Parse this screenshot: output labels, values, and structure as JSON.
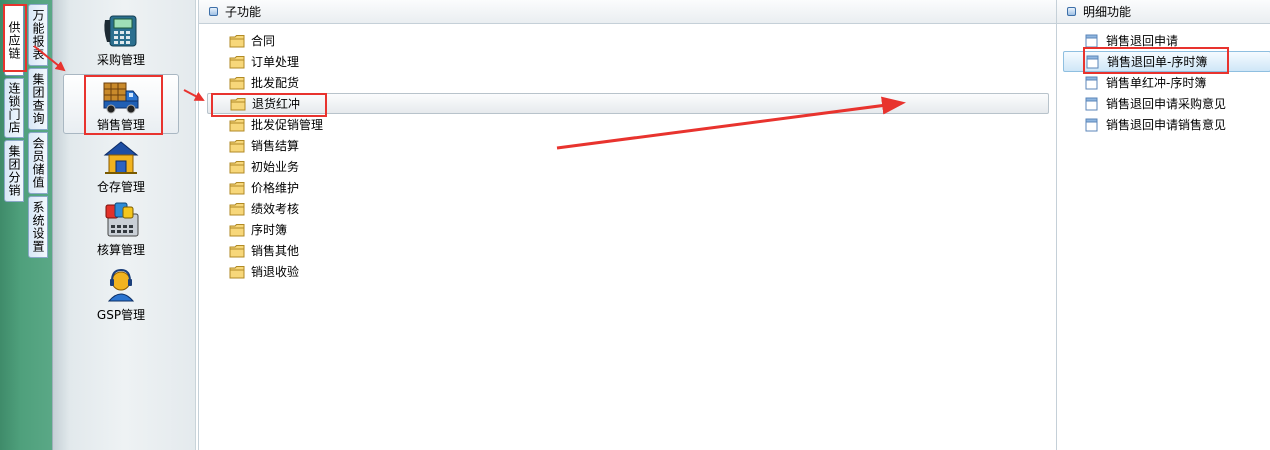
{
  "vertical_tabs": [
    {
      "label": "供应链",
      "active": true
    },
    {
      "label": "连锁门店",
      "active": false
    },
    {
      "label": "集团分销",
      "active": false
    },
    {
      "label": "万能报表",
      "active": false
    },
    {
      "label": "集团查询",
      "active": false
    },
    {
      "label": "会员储值",
      "active": false
    },
    {
      "label": "系统设置",
      "active": false
    }
  ],
  "modules": [
    {
      "label": "采购管理",
      "icon": "phone-register-icon"
    },
    {
      "label": "销售管理",
      "icon": "delivery-truck-icon",
      "selected": true
    },
    {
      "label": "仓存管理",
      "icon": "warehouse-house-icon"
    },
    {
      "label": "核算管理",
      "icon": "calculator-icon"
    },
    {
      "label": "GSP管理",
      "icon": "user-headset-icon"
    }
  ],
  "subfunction_panel": {
    "title": "子功能",
    "items": [
      {
        "label": "合同"
      },
      {
        "label": "订单处理"
      },
      {
        "label": "批发配货"
      },
      {
        "label": "退货红冲",
        "selected": true
      },
      {
        "label": "批发促销管理"
      },
      {
        "label": "销售结算"
      },
      {
        "label": "初始业务"
      },
      {
        "label": "价格维护"
      },
      {
        "label": "绩效考核"
      },
      {
        "label": "序时簿"
      },
      {
        "label": "销售其他"
      },
      {
        "label": "销退收验"
      }
    ]
  },
  "detail_panel": {
    "title": "明细功能",
    "items": [
      {
        "label": "销售退回申请"
      },
      {
        "label": "销售退回单-序时簿",
        "selected": true
      },
      {
        "label": "销售单红冲-序时簿"
      },
      {
        "label": "销售退回申请采购意见"
      },
      {
        "label": "销售退回申请销售意见"
      }
    ]
  },
  "colors": {
    "annotation": "#e8332e",
    "selection_blue": "#cfe6f7",
    "left_green": "#4fa07c"
  }
}
